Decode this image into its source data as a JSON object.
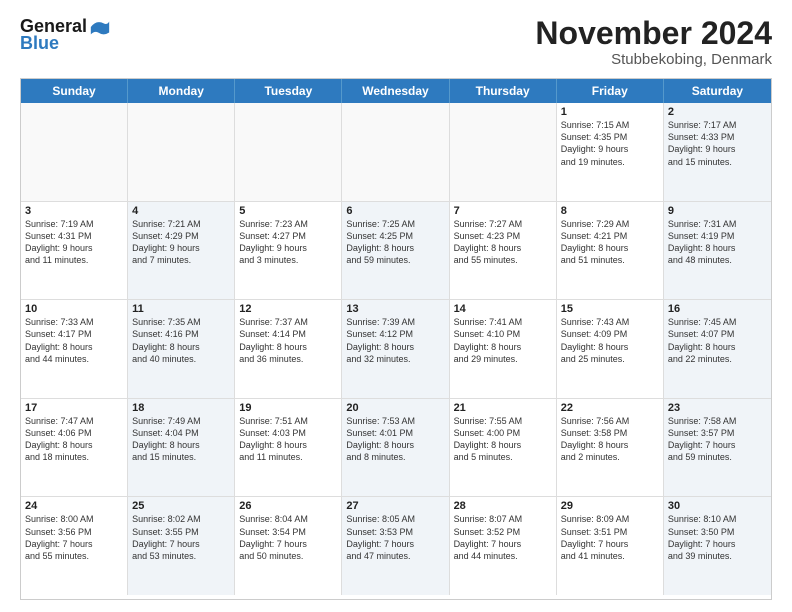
{
  "logo": {
    "line1": "General",
    "line2": "Blue"
  },
  "title": "November 2024",
  "location": "Stubbekobing, Denmark",
  "header_days": [
    "Sunday",
    "Monday",
    "Tuesday",
    "Wednesday",
    "Thursday",
    "Friday",
    "Saturday"
  ],
  "weeks": [
    [
      {
        "day": "",
        "info": "",
        "alt": false
      },
      {
        "day": "",
        "info": "",
        "alt": false
      },
      {
        "day": "",
        "info": "",
        "alt": false
      },
      {
        "day": "",
        "info": "",
        "alt": false
      },
      {
        "day": "",
        "info": "",
        "alt": false
      },
      {
        "day": "1",
        "info": "Sunrise: 7:15 AM\nSunset: 4:35 PM\nDaylight: 9 hours\nand 19 minutes.",
        "alt": false
      },
      {
        "day": "2",
        "info": "Sunrise: 7:17 AM\nSunset: 4:33 PM\nDaylight: 9 hours\nand 15 minutes.",
        "alt": true
      }
    ],
    [
      {
        "day": "3",
        "info": "Sunrise: 7:19 AM\nSunset: 4:31 PM\nDaylight: 9 hours\nand 11 minutes.",
        "alt": false
      },
      {
        "day": "4",
        "info": "Sunrise: 7:21 AM\nSunset: 4:29 PM\nDaylight: 9 hours\nand 7 minutes.",
        "alt": true
      },
      {
        "day": "5",
        "info": "Sunrise: 7:23 AM\nSunset: 4:27 PM\nDaylight: 9 hours\nand 3 minutes.",
        "alt": false
      },
      {
        "day": "6",
        "info": "Sunrise: 7:25 AM\nSunset: 4:25 PM\nDaylight: 8 hours\nand 59 minutes.",
        "alt": true
      },
      {
        "day": "7",
        "info": "Sunrise: 7:27 AM\nSunset: 4:23 PM\nDaylight: 8 hours\nand 55 minutes.",
        "alt": false
      },
      {
        "day": "8",
        "info": "Sunrise: 7:29 AM\nSunset: 4:21 PM\nDaylight: 8 hours\nand 51 minutes.",
        "alt": false
      },
      {
        "day": "9",
        "info": "Sunrise: 7:31 AM\nSunset: 4:19 PM\nDaylight: 8 hours\nand 48 minutes.",
        "alt": true
      }
    ],
    [
      {
        "day": "10",
        "info": "Sunrise: 7:33 AM\nSunset: 4:17 PM\nDaylight: 8 hours\nand 44 minutes.",
        "alt": false
      },
      {
        "day": "11",
        "info": "Sunrise: 7:35 AM\nSunset: 4:16 PM\nDaylight: 8 hours\nand 40 minutes.",
        "alt": true
      },
      {
        "day": "12",
        "info": "Sunrise: 7:37 AM\nSunset: 4:14 PM\nDaylight: 8 hours\nand 36 minutes.",
        "alt": false
      },
      {
        "day": "13",
        "info": "Sunrise: 7:39 AM\nSunset: 4:12 PM\nDaylight: 8 hours\nand 32 minutes.",
        "alt": true
      },
      {
        "day": "14",
        "info": "Sunrise: 7:41 AM\nSunset: 4:10 PM\nDaylight: 8 hours\nand 29 minutes.",
        "alt": false
      },
      {
        "day": "15",
        "info": "Sunrise: 7:43 AM\nSunset: 4:09 PM\nDaylight: 8 hours\nand 25 minutes.",
        "alt": false
      },
      {
        "day": "16",
        "info": "Sunrise: 7:45 AM\nSunset: 4:07 PM\nDaylight: 8 hours\nand 22 minutes.",
        "alt": true
      }
    ],
    [
      {
        "day": "17",
        "info": "Sunrise: 7:47 AM\nSunset: 4:06 PM\nDaylight: 8 hours\nand 18 minutes.",
        "alt": false
      },
      {
        "day": "18",
        "info": "Sunrise: 7:49 AM\nSunset: 4:04 PM\nDaylight: 8 hours\nand 15 minutes.",
        "alt": true
      },
      {
        "day": "19",
        "info": "Sunrise: 7:51 AM\nSunset: 4:03 PM\nDaylight: 8 hours\nand 11 minutes.",
        "alt": false
      },
      {
        "day": "20",
        "info": "Sunrise: 7:53 AM\nSunset: 4:01 PM\nDaylight: 8 hours\nand 8 minutes.",
        "alt": true
      },
      {
        "day": "21",
        "info": "Sunrise: 7:55 AM\nSunset: 4:00 PM\nDaylight: 8 hours\nand 5 minutes.",
        "alt": false
      },
      {
        "day": "22",
        "info": "Sunrise: 7:56 AM\nSunset: 3:58 PM\nDaylight: 8 hours\nand 2 minutes.",
        "alt": false
      },
      {
        "day": "23",
        "info": "Sunrise: 7:58 AM\nSunset: 3:57 PM\nDaylight: 7 hours\nand 59 minutes.",
        "alt": true
      }
    ],
    [
      {
        "day": "24",
        "info": "Sunrise: 8:00 AM\nSunset: 3:56 PM\nDaylight: 7 hours\nand 55 minutes.",
        "alt": false
      },
      {
        "day": "25",
        "info": "Sunrise: 8:02 AM\nSunset: 3:55 PM\nDaylight: 7 hours\nand 53 minutes.",
        "alt": true
      },
      {
        "day": "26",
        "info": "Sunrise: 8:04 AM\nSunset: 3:54 PM\nDaylight: 7 hours\nand 50 minutes.",
        "alt": false
      },
      {
        "day": "27",
        "info": "Sunrise: 8:05 AM\nSunset: 3:53 PM\nDaylight: 7 hours\nand 47 minutes.",
        "alt": true
      },
      {
        "day": "28",
        "info": "Sunrise: 8:07 AM\nSunset: 3:52 PM\nDaylight: 7 hours\nand 44 minutes.",
        "alt": false
      },
      {
        "day": "29",
        "info": "Sunrise: 8:09 AM\nSunset: 3:51 PM\nDaylight: 7 hours\nand 41 minutes.",
        "alt": false
      },
      {
        "day": "30",
        "info": "Sunrise: 8:10 AM\nSunset: 3:50 PM\nDaylight: 7 hours\nand 39 minutes.",
        "alt": true
      }
    ]
  ]
}
